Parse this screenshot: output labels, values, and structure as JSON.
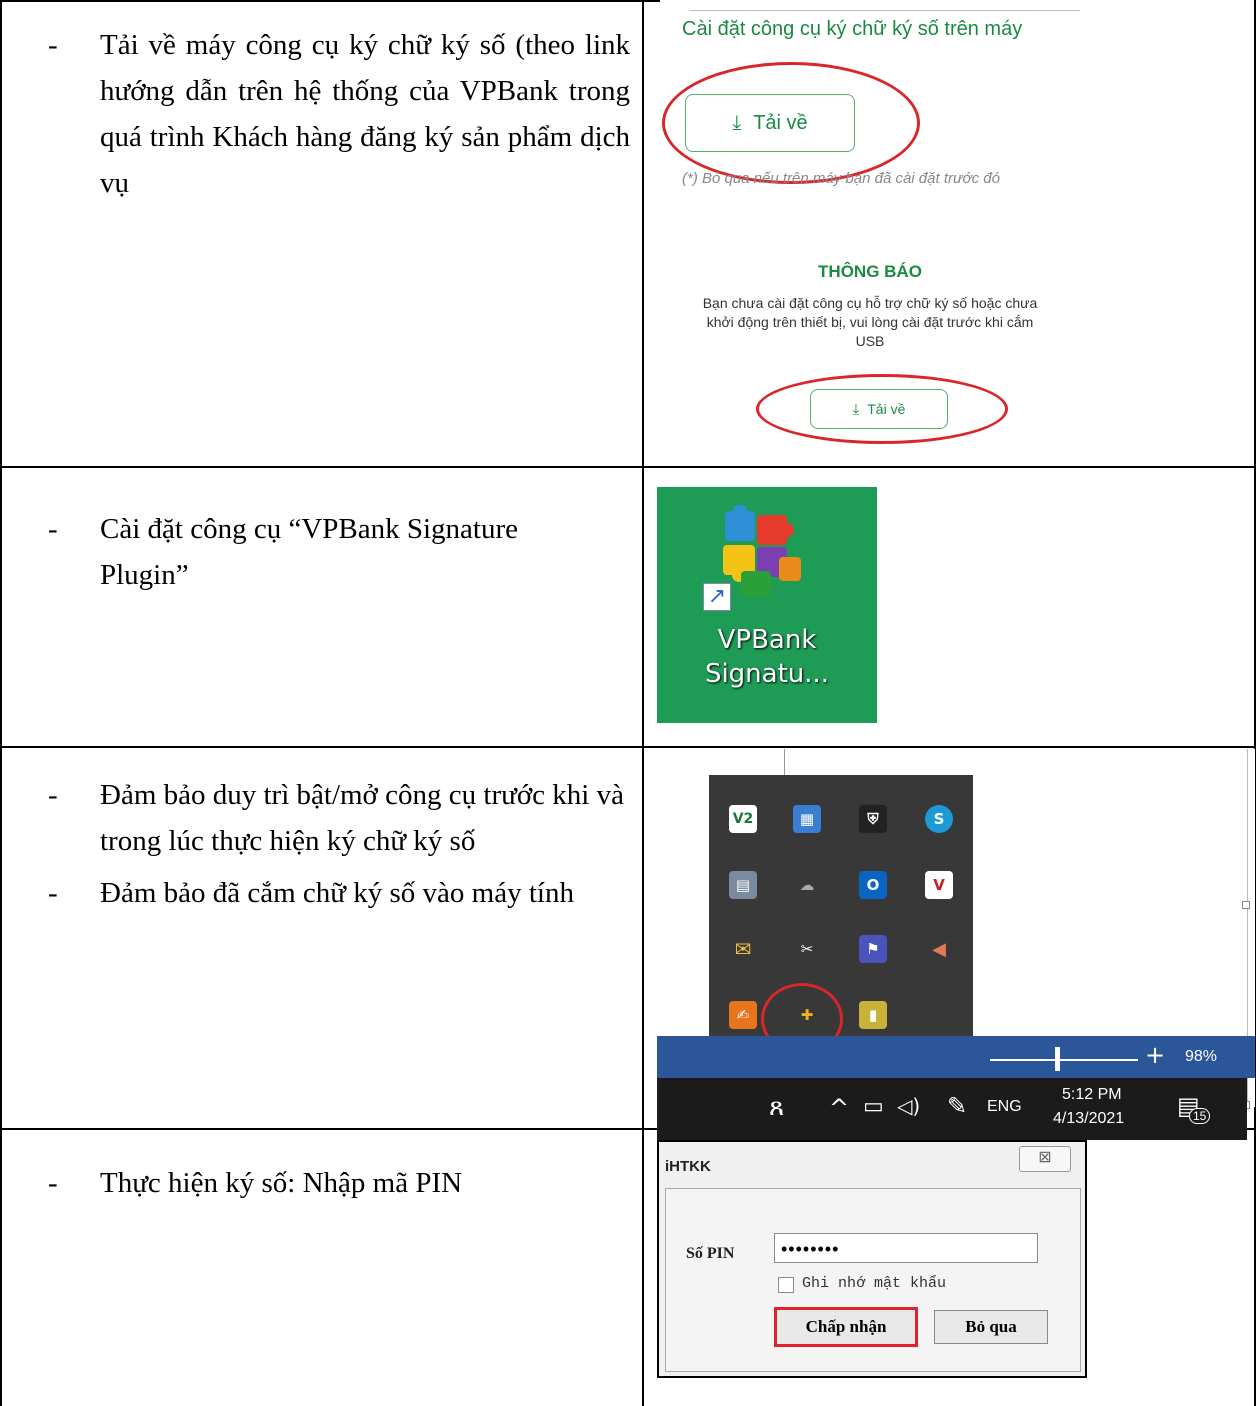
{
  "rows": [
    {
      "lines": [
        {
          "dash": "-",
          "text": "Tải về máy công cụ ký chữ ký số (theo link hướng dẫn trên hệ thống của VPBank trong quá trình Khách hàng đăng ký sản phẩm dịch vụ"
        }
      ]
    },
    {
      "lines": [
        {
          "dash": "-",
          "text": "Cài đặt công cụ “VPBank Signature Plugin”"
        }
      ]
    },
    {
      "lines": [
        {
          "dash": "-",
          "text": "Đảm bảo duy trì bật/mở công cụ trước khi và trong lúc thực hiện ký chữ ký số"
        },
        {
          "dash": "-",
          "text": "Đảm bảo đã cắm chữ ký số vào máy tính"
        }
      ]
    },
    {
      "lines": [
        {
          "dash": "-",
          "text": "Thực hiện ký số: Nhập mã PIN"
        }
      ]
    }
  ],
  "download_panel": {
    "heading": "Cài đặt công cụ ký chữ ký số trên máy",
    "download_label": "Tải về",
    "note": "(*) Bỏ qua nếu trên máy bạn đã cài đặt trước đó",
    "notice_title": "THÔNG BÁO",
    "notice_body": "Bạn chưa cài đặt công cụ hỗ trợ chữ ký số hoặc chưa khởi động trên thiết bị, vui lòng cài đặt trước khi cắm USB",
    "download_label_2": "Tải về",
    "download_icon": "download-icon",
    "accent_color": "#1a8a43",
    "highlight_color": "#d9262b"
  },
  "shortcut_panel": {
    "label_line1": "VPBank",
    "label_line2": "Signatu...",
    "icon": "puzzle-icon",
    "background_color": "#1e9c55"
  },
  "tray_panel": {
    "icons": [
      "V2",
      "▦",
      "⛨",
      "S",
      "▤",
      "☁",
      "O",
      "V",
      "✉",
      "✂",
      "⚑",
      "◀",
      "✍",
      "✚",
      "▮"
    ],
    "zoom_percent": "98%",
    "zoom_plus": "+",
    "time": "5:12 PM",
    "date": "4/13/2021",
    "language": "ENG",
    "notification_count": "15",
    "taskbar_icons": [
      "people-icon",
      "chevron-up-icon",
      "network-icon",
      "volume-icon",
      "pen-icon"
    ]
  },
  "pin_dialog": {
    "title": "iHTKK",
    "close_glyph": "⊠",
    "pin_label": "Số PIN",
    "pin_value": "••••••••",
    "remember_label": "Ghi nhớ mật khẩu",
    "ok_label": "Chấp nhận",
    "cancel_label": "Bỏ qua"
  }
}
